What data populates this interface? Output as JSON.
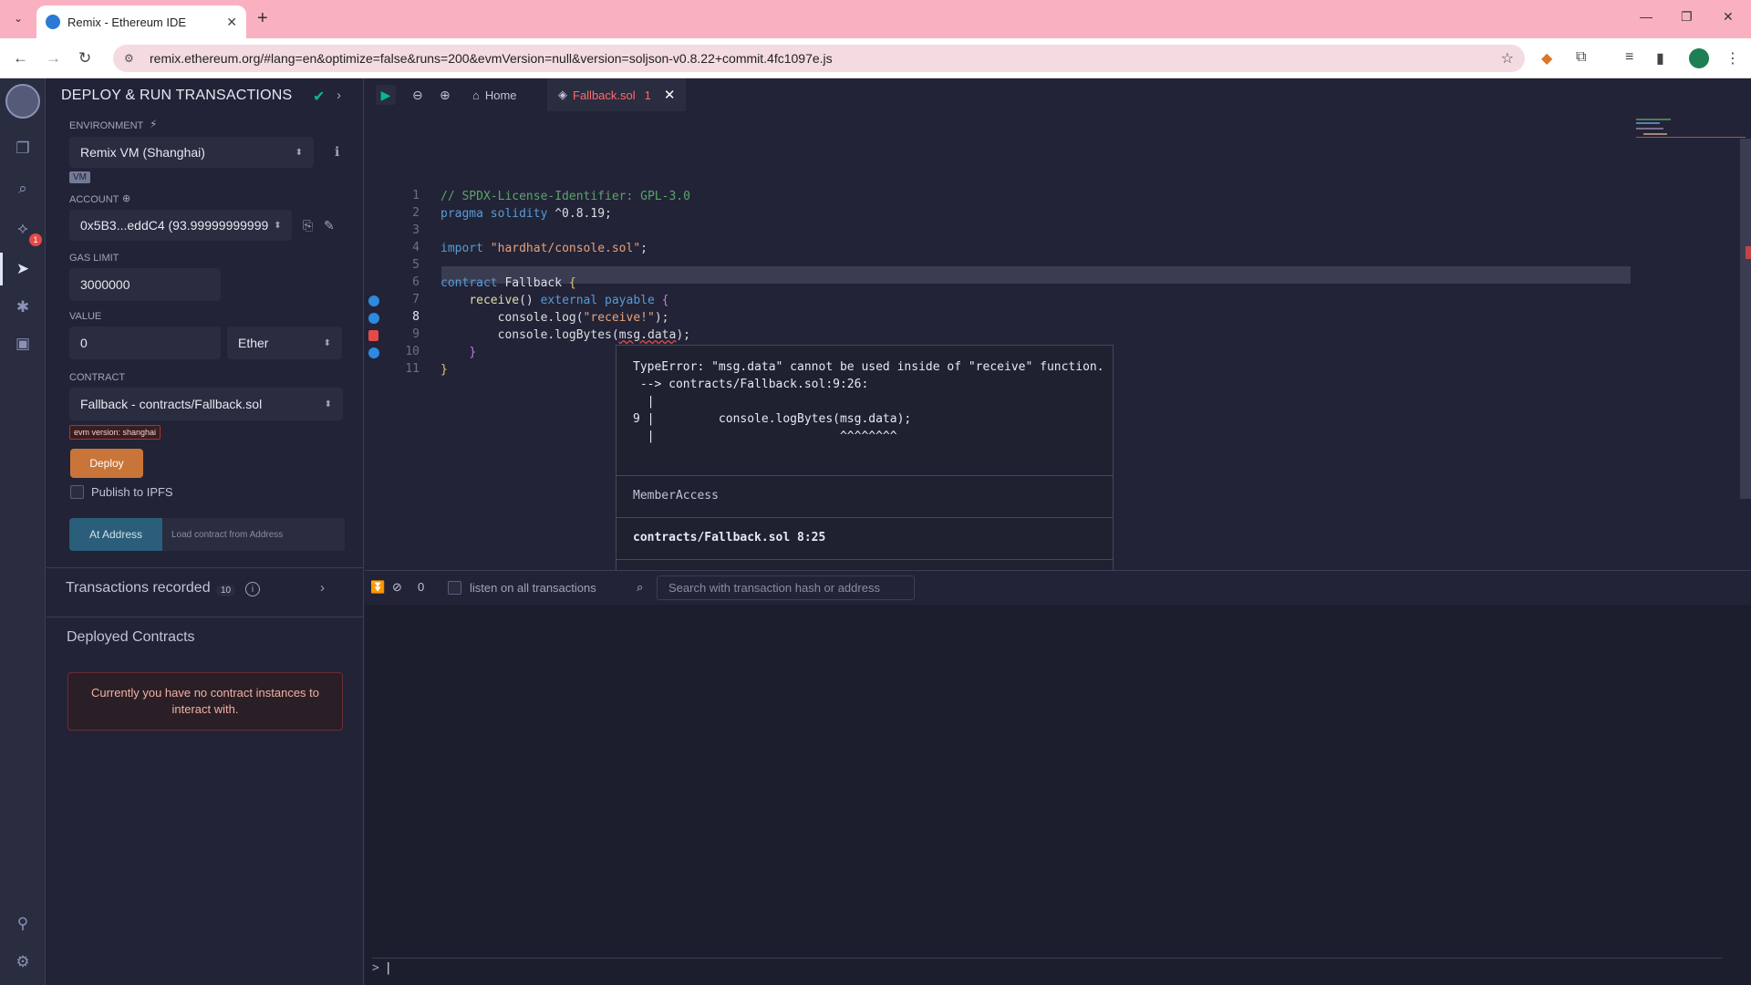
{
  "browser": {
    "tab_title": "Remix - Ethereum IDE",
    "url": "remix.ethereum.org/#lang=en&optimize=false&runs=200&evmVersion=null&version=soljson-v0.8.22+commit.4fc1097e.js"
  },
  "panel": {
    "title": "DEPLOY & RUN TRANSACTIONS",
    "environment_label": "ENVIRONMENT",
    "environment_value": "Remix VM (Shanghai)",
    "vm_badge": "VM",
    "account_label": "ACCOUNT",
    "account_value": "0x5B3...eddC4 (93.99999999999",
    "gas_limit_label": "GAS LIMIT",
    "gas_limit_value": "3000000",
    "value_label": "VALUE",
    "value_amount": "0",
    "value_unit": "Ether",
    "contract_label": "CONTRACT",
    "contract_value": "Fallback - contracts/Fallback.sol",
    "evm_badge": "evm version: shanghai",
    "deploy_label": "Deploy",
    "ipfs_label": "Publish to IPFS",
    "at_address_label": "At Address",
    "load_address_placeholder": "Load contract from Address",
    "transactions_recorded": "Transactions recorded",
    "transactions_count": "10",
    "deployed_contracts": "Deployed Contracts",
    "no_instances": "Currently you have no contract instances to interact with."
  },
  "iconbar": {
    "badge_count": "1"
  },
  "editor": {
    "home_tab": "Home",
    "file_tab": "Fallback.sol",
    "file_tab_errors": "1",
    "line_numbers": [
      "1",
      "2",
      "3",
      "4",
      "5",
      "6",
      "7",
      "8",
      "9",
      "10",
      "11"
    ],
    "code": {
      "l1": "// SPDX-License-Identifier: GPL-3.0",
      "l2_kw": "pragma solidity",
      "l2_rest": " ^0.8.19;",
      "l4_kw": "import",
      "l4_str": "\"hardhat/console.sol\"",
      "l4_end": ";",
      "l6_kw": "contract",
      "l6_name": " Fallback ",
      "l7_fn": "receive",
      "l7_mid": "() ",
      "l7_kw": "external payable",
      "l8_a": "console.log(",
      "l8_str": "\"receive!\"",
      "l8_b": ");",
      "l9_a": "console.logBytes(",
      "l9_arg": "msg.data",
      "l9_b": ");"
    }
  },
  "popup": {
    "message": "TypeError: \"msg.data\" cannot be used inside of \"receive\" function.\n --> contracts/Fallback.sol:9:26:\n  |\n9 |         console.logBytes(msg.data);\n  |                          ^^^^^^^^",
    "kind": "MemberAccess",
    "location": "contracts/Fallback.sol 8:25"
  },
  "terminal": {
    "pending_count": "0",
    "listen_label": "listen on all transactions",
    "search_placeholder": "Search with transaction hash or address",
    "prompt": ">"
  }
}
